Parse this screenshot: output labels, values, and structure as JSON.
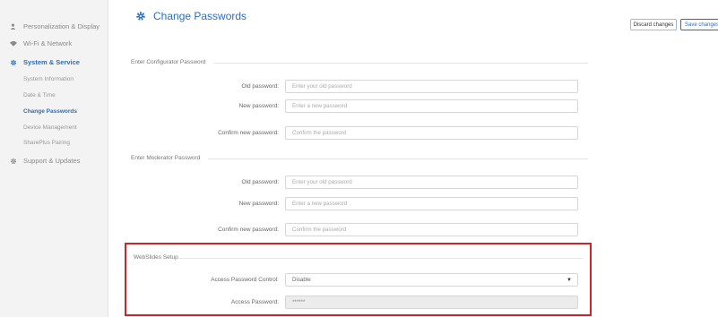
{
  "sidebar": {
    "items": [
      {
        "label": "Personalization & Display",
        "icon": "person-icon"
      },
      {
        "label": "Wi-Fi & Network",
        "icon": "wifi-icon"
      },
      {
        "label": "System & Service",
        "icon": "gear-icon"
      },
      {
        "label": "Support & Updates",
        "icon": "gear-icon"
      }
    ],
    "subitems": [
      "System Information",
      "Date & Time",
      "Change Passwords",
      "Device Management",
      "SharePlus Pairing"
    ],
    "active_subitem": "Change Passwords"
  },
  "header": {
    "title": "Change Passwords",
    "discard_label": "Discard changes",
    "save_label": "Save changes"
  },
  "configurator": {
    "heading": "Enter Configurator Password",
    "old_label": "Old password:",
    "old_placeholder": "Enter your old password",
    "new_label": "New password:",
    "new_placeholder": "Enter a new password",
    "confirm_label": "Confirm new password:",
    "confirm_placeholder": "Confirm the password"
  },
  "moderator": {
    "heading": "Enter Moderator Password",
    "old_label": "Old password:",
    "old_placeholder": "Enter your old password",
    "new_label": "New password:",
    "new_placeholder": "Enter a new password",
    "confirm_label": "Confirm new password:",
    "confirm_placeholder": "Confirm the password"
  },
  "webslides": {
    "heading": "WebSlides Setup",
    "control_label": "Access Password Control:",
    "control_value": "Disable",
    "password_label": "Access Password:",
    "password_value": "******"
  },
  "colors": {
    "accent": "#2a6ebb",
    "highlight": "#c9262c"
  }
}
